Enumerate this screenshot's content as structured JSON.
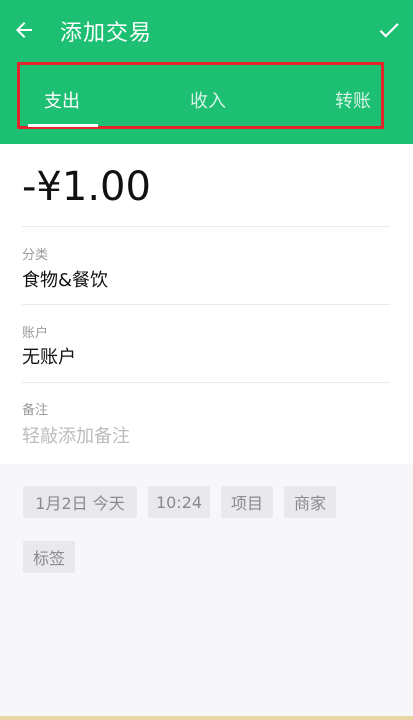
{
  "header": {
    "title": "添加交易",
    "tabs": [
      {
        "label": "支出"
      },
      {
        "label": "收入"
      },
      {
        "label": "转账"
      }
    ]
  },
  "form": {
    "amount": "-¥1.00",
    "category_label": "分类",
    "category_value": "食物&餐饮",
    "account_label": "账户",
    "account_value": "无账户",
    "note_label": "备注",
    "note_placeholder": "轻敲添加备注"
  },
  "chips": [
    {
      "label": "1月2日  今天"
    },
    {
      "label": "10:24"
    },
    {
      "label": "项目"
    },
    {
      "label": "商家"
    },
    {
      "label": "标签"
    }
  ],
  "colors": {
    "primary": "#1dbf73",
    "highlight_border": "#e3242b"
  }
}
